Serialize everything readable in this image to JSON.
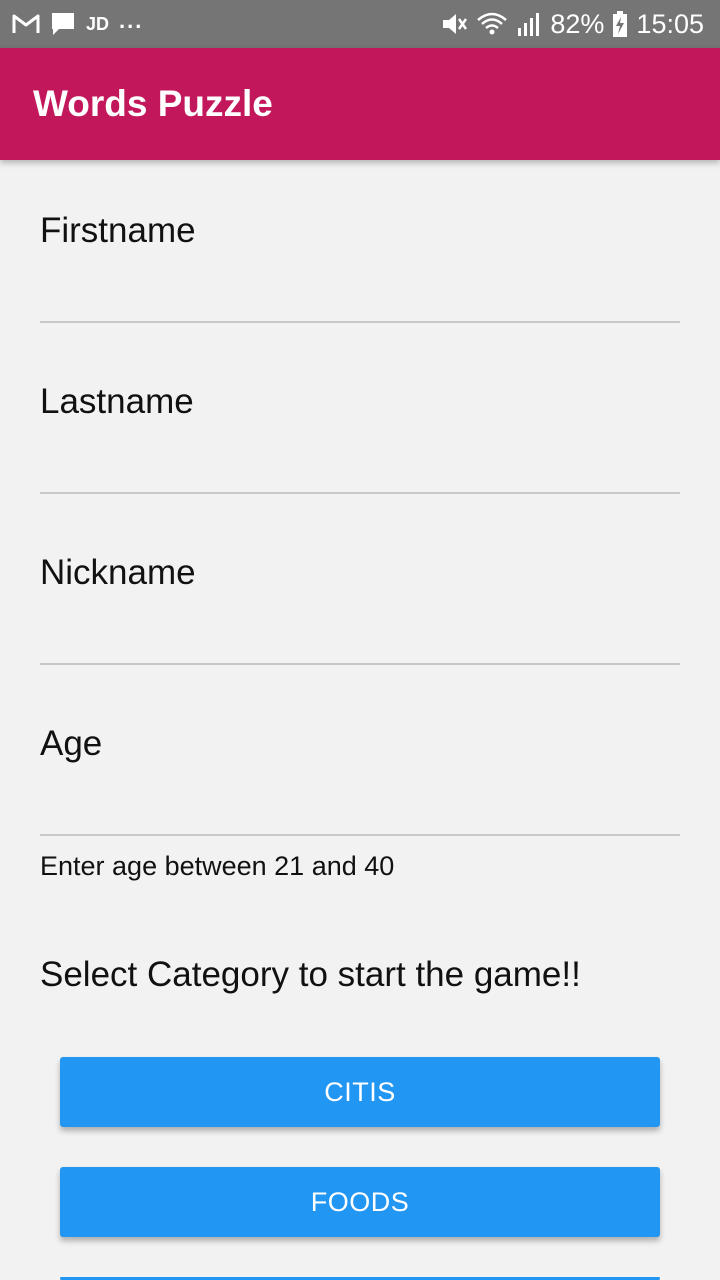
{
  "status_bar": {
    "carrier_badge": "JD",
    "overflow": "...",
    "battery": "82%",
    "time": "15:05",
    "icons": [
      "gmail-icon",
      "message-icon",
      "mute-icon",
      "wifi-icon",
      "signal-icon",
      "battery-charging-icon"
    ]
  },
  "app_bar": {
    "title": "Words Puzzle",
    "color": "#c2185b"
  },
  "form": {
    "firstname_label": "Firstname",
    "lastname_label": "Lastname",
    "nickname_label": "Nickname",
    "age_label": "Age",
    "age_helper": "Enter age between 21 and 40"
  },
  "category": {
    "heading": "Select Category to start the game!!",
    "buttons": [
      {
        "label": "CITIS"
      },
      {
        "label": "FOODS"
      }
    ],
    "button_color": "#2196f3"
  }
}
